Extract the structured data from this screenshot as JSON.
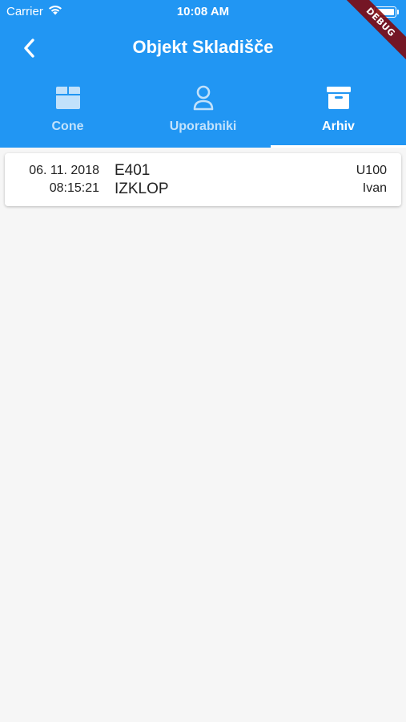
{
  "status_bar": {
    "carrier": "Carrier",
    "time": "10:08 AM",
    "wifi_icon": "wifi-icon",
    "battery_icon": "battery-icon",
    "battery_level": 1.0
  },
  "app_bar": {
    "title": "Objekt Skladišče",
    "back_icon": "chevron-left-icon"
  },
  "debug_banner": "DEBUG",
  "tabs": [
    {
      "label": "Cone",
      "icon": "box-icon",
      "selected": false
    },
    {
      "label": "Uporabniki",
      "icon": "person-icon",
      "selected": false
    },
    {
      "label": "Arhiv",
      "icon": "archive-icon",
      "selected": true
    }
  ],
  "archive": [
    {
      "date": "06. 11. 2018",
      "time": "08:15:21",
      "code": "E401",
      "event": "IZKLOP",
      "user_code": "U100",
      "user_name": "Ivan"
    }
  ],
  "colors": {
    "primary": "#2196f3",
    "background": "#f6f6f6",
    "card": "#ffffff",
    "text": "#222222"
  }
}
